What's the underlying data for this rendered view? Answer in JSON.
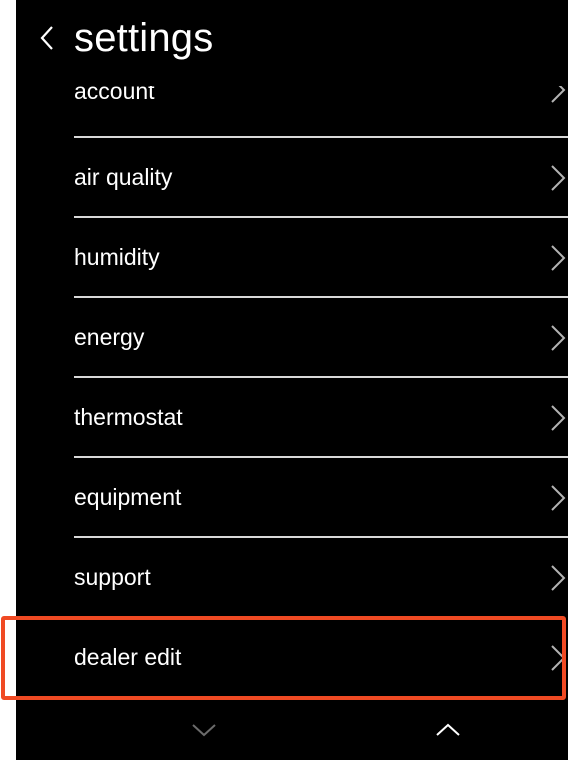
{
  "header": {
    "title": "settings",
    "back_icon": "chevron-left-icon"
  },
  "menu": {
    "items": [
      {
        "label": "account"
      },
      {
        "label": "air quality"
      },
      {
        "label": "humidity"
      },
      {
        "label": "energy"
      },
      {
        "label": "thermostat"
      },
      {
        "label": "equipment"
      },
      {
        "label": "support"
      },
      {
        "label": "dealer edit"
      }
    ]
  },
  "highlight": {
    "item": "dealer edit",
    "color": "#f04a23"
  },
  "bottom_nav": {
    "down_icon": "chevron-down-icon",
    "up_icon": "chevron-up-icon"
  },
  "colors": {
    "background": "#000000",
    "text": "#ffffff",
    "divider": "#d9d9d9",
    "chevron": "#b3b3b3",
    "disabled_nav": "#6b6b6b"
  }
}
